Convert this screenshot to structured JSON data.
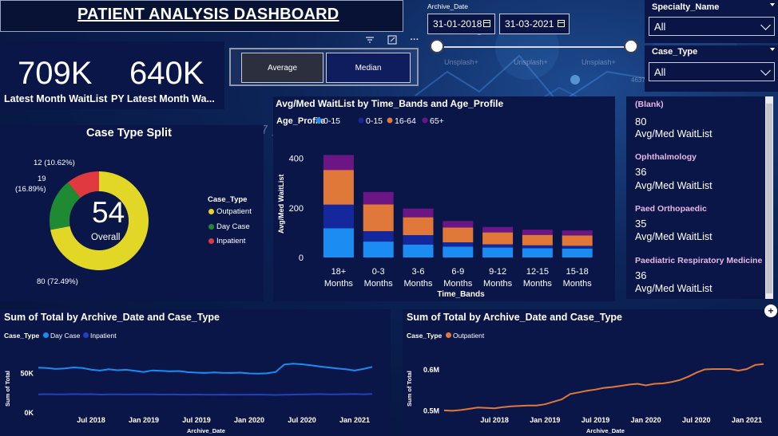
{
  "dashboard": {
    "title": "PATIENT ANALYSIS DASHBOARD"
  },
  "kpis": [
    {
      "value": "709K",
      "label": "Latest Month WaitList"
    },
    {
      "value": "640K",
      "label": "PY Latest Month Wa..."
    }
  ],
  "toggle": {
    "options": [
      "Average",
      "Median"
    ],
    "selected": "Median"
  },
  "visual_menu": {
    "icons": [
      "filter-icon",
      "focus-mode-icon",
      "more-options-icon"
    ],
    "more_glyph": "···"
  },
  "date_slicer": {
    "label": "Archive_Date",
    "start": "31-01-2018",
    "end": "31-03-2021"
  },
  "specialty_slicer": {
    "label": "Specialty_Name",
    "value": "All"
  },
  "case_type_slicer": {
    "label": "Case_Type",
    "value": "All"
  },
  "background_watermarks": [
    "Unsplash+",
    "Unsplash+",
    "Unsplash+",
    "4637",
    "4637",
    "4637",
    "4637"
  ],
  "focus_glyph": "+",
  "donut": {
    "title": "Case Type Split",
    "center_value": "54",
    "center_label": "Overall",
    "legend_title": "Case_Type",
    "slices": [
      {
        "label": "Outpatient",
        "value": 80,
        "percent": "72.49%",
        "data_label": "80 (72.49%)",
        "color": "#e2d626"
      },
      {
        "label": "Day Case",
        "value": 19,
        "percent": "16.89%",
        "data_label_line1": "19",
        "data_label_line2": "(16.89%)",
        "color": "#1f8a34"
      },
      {
        "label": "Inpatient",
        "value": 12,
        "percent": "10.62%",
        "data_label": "12 (10.62%)",
        "color": "#e03a3e"
      }
    ]
  },
  "cards": [
    {
      "name": "(Blank)",
      "value": "80",
      "label": "Avg/Med WaitList"
    },
    {
      "name": "Ophthalmology",
      "value": "36",
      "label": "Avg/Med WaitList"
    },
    {
      "name": "Paed Orthopaedic",
      "value": "35",
      "label": "Avg/Med WaitList"
    },
    {
      "name": "Paediatric Respiratory Medicine",
      "value": "36",
      "label": "Avg/Med WaitList"
    }
  ],
  "chart_data": [
    {
      "type": "bar",
      "stacked": true,
      "title": "Avg/Med WaitList by Time_Bands and Age_Profile",
      "legend_title": "Age_Profile",
      "legend_position": "top-left",
      "xlabel": "Time_Bands",
      "ylabel": "Avg/Med WaitList",
      "ylim": [
        0,
        450
      ],
      "yticks": [
        0,
        200,
        400
      ],
      "categories": [
        "18+ Months",
        "0-3 Months",
        "3-6 Months",
        "6-9 Months",
        "9-12 Months",
        "12-15 Months",
        "15-18 Months"
      ],
      "category_lines": [
        [
          "18+",
          "Months"
        ],
        [
          "0-3",
          "Months"
        ],
        [
          "3-6",
          "Months"
        ],
        [
          "6-9",
          "Months"
        ],
        [
          "9-12",
          "Months"
        ],
        [
          "12-15",
          "Months"
        ],
        [
          "15-18",
          "Months"
        ]
      ],
      "series": [
        {
          "name": "0-15",
          "color": "#1b8cf2",
          "values": [
            118,
            64,
            52,
            44,
            40,
            37,
            36
          ]
        },
        {
          "name": "0-15",
          "color": "#14279c",
          "values": [
            95,
            42,
            38,
            17,
            13,
            12,
            11
          ]
        },
        {
          "name": "16-64",
          "color": "#e0783a",
          "values": [
            140,
            108,
            72,
            60,
            48,
            42,
            42
          ]
        },
        {
          "name": "65+",
          "color": "#6c1585",
          "values": [
            60,
            50,
            35,
            26,
            22,
            21,
            20
          ]
        }
      ]
    },
    {
      "type": "line",
      "title": "Sum of Total by Archive_Date and Case_Type",
      "legend_title": "Case_Type",
      "legend_position": "top-left",
      "xlabel": "Archive_Date",
      "ylabel": "Sum of Total",
      "x_range": [
        "2018-01",
        "2021-03"
      ],
      "xticks": [
        "Jul 2018",
        "Jan 2019",
        "Jul 2019",
        "Jan 2020",
        "Jul 2020",
        "Jan 2021"
      ],
      "yticks": [
        "0K",
        "50K"
      ],
      "ylim": [
        0,
        75000
      ],
      "x": [
        "Jan 2018",
        "Feb 2018",
        "Mar 2018",
        "Apr 2018",
        "May 2018",
        "Jun 2018",
        "Jul 2018",
        "Aug 2018",
        "Sep 2018",
        "Oct 2018",
        "Nov 2018",
        "Dec 2018",
        "Jan 2019",
        "Feb 2019",
        "Mar 2019",
        "Apr 2019",
        "May 2019",
        "Jun 2019",
        "Jul 2019",
        "Aug 2019",
        "Sep 2019",
        "Oct 2019",
        "Nov 2019",
        "Dec 2019",
        "Jan 2020",
        "Feb 2020",
        "Mar 2020",
        "Apr 2020",
        "May 2020",
        "Jun 2020",
        "Jul 2020",
        "Aug 2020",
        "Sep 2020",
        "Oct 2020",
        "Nov 2020",
        "Dec 2020",
        "Jan 2021",
        "Feb 2021",
        "Mar 2021"
      ],
      "series": [
        {
          "name": "Day Case",
          "color": "#1b8cf2",
          "values": [
            57500,
            57000,
            55800,
            56500,
            57800,
            57200,
            55000,
            53800,
            55500,
            54200,
            54800,
            53500,
            52000,
            54000,
            53500,
            52800,
            53200,
            51800,
            51200,
            50800,
            51500,
            51000,
            50800,
            51200,
            50200,
            50000,
            50300,
            52000,
            61500,
            62500,
            61800,
            60500,
            59000,
            57800,
            56500,
            55500,
            53800,
            55800,
            58500
          ]
        },
        {
          "name": "Inpatient",
          "color": "#1f3fc4",
          "values": [
            23500,
            23800,
            23500,
            23600,
            23900,
            23700,
            23800,
            23300,
            23500,
            23500,
            23400,
            23600,
            23500,
            23500,
            23300,
            23400,
            23300,
            23200,
            23400,
            23200,
            23100,
            23300,
            23100,
            23200,
            23200,
            23300,
            23100,
            22800,
            23100,
            23300,
            23400,
            23700,
            23900,
            23600,
            23600,
            23800,
            24000,
            23600,
            24200
          ]
        }
      ]
    },
    {
      "type": "line",
      "title": "Sum of Total by Archive_Date and Case_Type",
      "legend_title": "Case_Type",
      "legend_position": "top-left",
      "xlabel": "Archive_Date",
      "ylabel": "Sum of Total",
      "x_range": [
        "2018-01",
        "2021-03"
      ],
      "xticks": [
        "Jul 2018",
        "Jan 2019",
        "Jul 2019",
        "Jan 2020",
        "Jul 2020",
        "Jan 2021"
      ],
      "yticks": [
        "0.5M",
        "0.6M"
      ],
      "ylim": [
        0.495,
        0.635
      ],
      "x": [
        "Jan 2018",
        "Feb 2018",
        "Mar 2018",
        "Apr 2018",
        "May 2018",
        "Jun 2018",
        "Jul 2018",
        "Aug 2018",
        "Sep 2018",
        "Oct 2018",
        "Nov 2018",
        "Dec 2018",
        "Jan 2019",
        "Feb 2019",
        "Mar 2019",
        "Apr 2019",
        "May 2019",
        "Jun 2019",
        "Jul 2019",
        "Aug 2019",
        "Sep 2019",
        "Oct 2019",
        "Nov 2019",
        "Dec 2019",
        "Jan 2020",
        "Feb 2020",
        "Mar 2020",
        "Apr 2020",
        "May 2020",
        "Jun 2020",
        "Jul 2020",
        "Aug 2020",
        "Sep 2020",
        "Oct 2020",
        "Nov 2020",
        "Dec 2020",
        "Jan 2021",
        "Feb 2021",
        "Mar 2021"
      ],
      "series": [
        {
          "name": "Outpatient",
          "color": "#e0783a",
          "values": [
            0.501,
            0.5,
            0.502,
            0.505,
            0.508,
            0.507,
            0.506,
            0.509,
            0.511,
            0.512,
            0.513,
            0.513,
            0.516,
            0.522,
            0.528,
            0.541,
            0.545,
            0.549,
            0.552,
            0.556,
            0.558,
            0.561,
            0.564,
            0.566,
            0.562,
            0.566,
            0.567,
            0.57,
            0.575,
            0.583,
            0.593,
            0.601,
            0.602,
            0.602,
            0.602,
            0.598,
            0.602,
            0.612,
            0.614
          ]
        }
      ]
    }
  ]
}
